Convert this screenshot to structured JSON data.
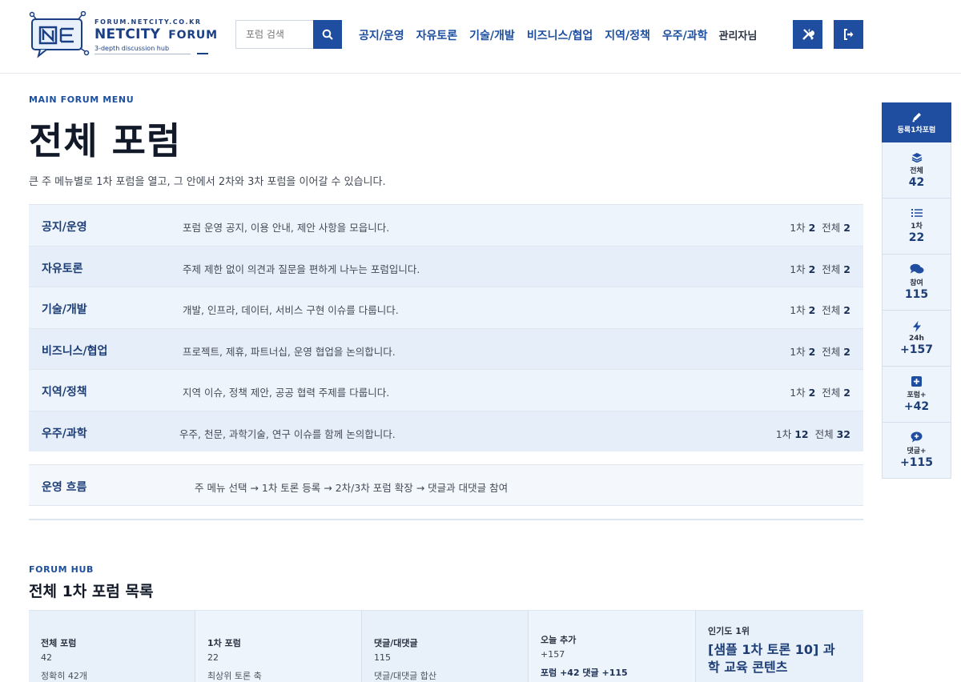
{
  "logo": {
    "domain": "FORUM.NETCITY.CO.KR",
    "name": "NETCITY",
    "forum": "FORUM",
    "tagline": "3-depth discussion hub"
  },
  "search": {
    "placeholder": "포럼 검색"
  },
  "nav": {
    "items": [
      "공지/운영",
      "자유토론",
      "기술/개발",
      "비즈니스/협업",
      "지역/정책",
      "우주/과학"
    ],
    "admin": "관리자님"
  },
  "main": {
    "eyebrow": "MAIN FORUM MENU",
    "title": "전체 포럼",
    "lead": "큰 주 메뉴별로 1차 포럼을 열고, 그 안에서 2차와 3차 포럼을 이어갈 수 있습니다.",
    "rows": [
      {
        "name": "공지/운영",
        "desc": "포럼 운영 공지, 이용 안내, 제안 사항을 모읍니다.",
        "first_label": "1차",
        "first": "2",
        "total_label": "전체",
        "total": "2"
      },
      {
        "name": "자유토론",
        "desc": "주제 제한 없이 의견과 질문을 편하게 나누는 포럼입니다.",
        "first_label": "1차",
        "first": "2",
        "total_label": "전체",
        "total": "2"
      },
      {
        "name": "기술/개발",
        "desc": "개발, 인프라, 데이터, 서비스 구현 이슈를 다룹니다.",
        "first_label": "1차",
        "first": "2",
        "total_label": "전체",
        "total": "2"
      },
      {
        "name": "비즈니스/협업",
        "desc": "프로젝트, 제휴, 파트너십, 운영 협업을 논의합니다.",
        "first_label": "1차",
        "first": "2",
        "total_label": "전체",
        "total": "2"
      },
      {
        "name": "지역/정책",
        "desc": "지역 이슈, 정책 제안, 공공 협력 주제를 다룹니다.",
        "first_label": "1차",
        "first": "2",
        "total_label": "전체",
        "total": "2"
      },
      {
        "name": "우주/과학",
        "desc": "우주, 천문, 과학기술, 연구 이슈를 함께 논의합니다.",
        "first_label": "1차",
        "first": "12",
        "total_label": "전체",
        "total": "32"
      }
    ],
    "flow": {
      "name": "운영 흐름",
      "text": "주 메뉴 선택 → 1차 토론 등록 → 2차/3차 포럼 확장 → 댓글과 대댓글 참여"
    }
  },
  "hub": {
    "eyebrow": "FORUM HUB",
    "title": "전체 1차 포럼 목록",
    "stats": [
      {
        "label": "전체 포럼",
        "value": "42",
        "sub": "정확히 42개"
      },
      {
        "label": "1차 포럼",
        "value": "22",
        "sub": "최상위 토론 축"
      },
      {
        "label": "댓글/대댓글",
        "value": "115",
        "sub": "댓글/대댓글 합산"
      },
      {
        "label": "오늘 추가",
        "value": "+157",
        "sub": "포럼 +42   댓글 +115"
      },
      {
        "label": "인기도 1위",
        "value": "[샘플 1차 토론 10] 과학 교육 콘텐츠"
      }
    ]
  },
  "rail": {
    "top": "등록1차포럼",
    "items": [
      {
        "label": "전체",
        "value": "42"
      },
      {
        "label": "1차",
        "value": "22"
      },
      {
        "label": "참여",
        "value": "115"
      },
      {
        "label": "24h",
        "value": "+157"
      },
      {
        "label": "포럼+",
        "value": "+42"
      },
      {
        "label": "댓글+",
        "value": "+115"
      }
    ]
  }
}
